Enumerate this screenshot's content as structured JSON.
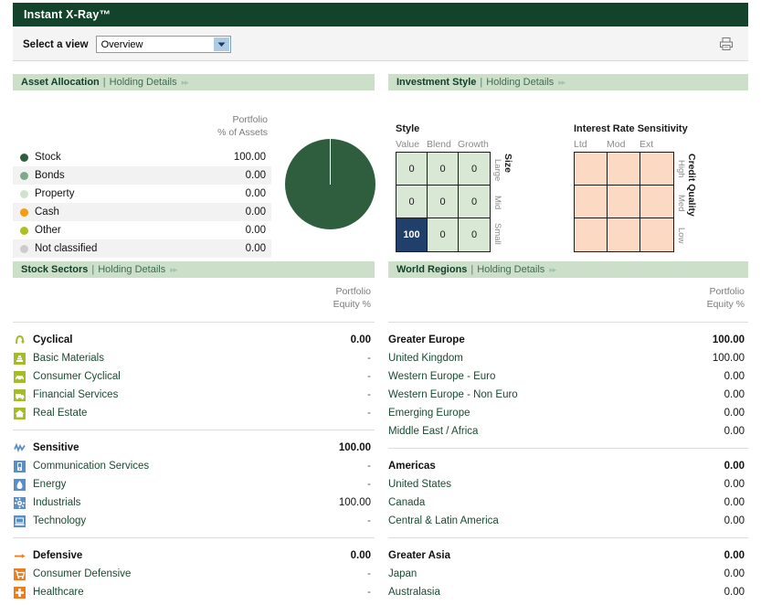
{
  "window": {
    "title": "Instant X-Ray™"
  },
  "toolbar": {
    "select_label": "Select a view",
    "view_value": "Overview",
    "view_options": [
      "Overview"
    ],
    "print_icon": "printer-icon",
    "dropdown_icon": "chevron-down-icon"
  },
  "panels": {
    "asset_allocation": {
      "title": "Asset Allocation",
      "separator": "|",
      "link": "Holding Details",
      "arrows": "▸▸",
      "col_header_line1": "Portfolio",
      "col_header_line2": "% of Assets",
      "rows": [
        {
          "label": "Stock",
          "value": "100.00",
          "color": "#2f5e3f"
        },
        {
          "label": "Bonds",
          "value": "0.00",
          "color": "#7fa98a"
        },
        {
          "label": "Property",
          "value": "0.00",
          "color": "#cfe4cd"
        },
        {
          "label": "Cash",
          "value": "0.00",
          "color": "#f59b12"
        },
        {
          "label": "Other",
          "value": "0.00",
          "color": "#afc024"
        },
        {
          "label": "Not classified",
          "value": "0.00",
          "color": "#cccccc"
        }
      ],
      "pie": {
        "slice_color": "#2f5e3f",
        "slice_value": 100
      }
    },
    "investment_style": {
      "title": "Investment Style",
      "separator": "|",
      "link": "Holding Details",
      "arrows": "▸▸",
      "style_box": {
        "title": "Style",
        "columns": [
          "Value",
          "Blend",
          "Growth"
        ],
        "rows": [
          "Large",
          "Mid",
          "Small"
        ],
        "axis_name": "Size",
        "values": [
          [
            "0",
            "0",
            "0"
          ],
          [
            "0",
            "0",
            "0"
          ],
          [
            "100",
            "0",
            "0"
          ]
        ],
        "highlight_row": 2,
        "highlight_col": 0,
        "cell_color": "#d8e8d5",
        "highlight_color": "#20406b"
      },
      "interest_rate_box": {
        "title": "Interest Rate Sensitivity",
        "columns": [
          "Ltd",
          "Mod",
          "Ext"
        ],
        "rows": [
          "High",
          "Med",
          "Low"
        ],
        "axis_name": "Credit Quality",
        "values": [
          [
            "",
            "",
            ""
          ],
          [
            "",
            "",
            ""
          ],
          [
            "",
            "",
            ""
          ]
        ],
        "cell_color": "#fbd9c2"
      }
    },
    "stock_sectors": {
      "title": "Stock Sectors",
      "separator": "|",
      "link": "Holding Details",
      "arrows": "▸▸",
      "col_header_line1": "Portfolio",
      "col_header_line2": "Equity %",
      "groups": [
        {
          "name": "Cyclical",
          "value": "0.00",
          "icon": "cyclical-icon",
          "color": "#a4bc2a",
          "items": [
            {
              "label": "Basic Materials",
              "value": "-",
              "icon": "basic-materials-icon"
            },
            {
              "label": "Consumer Cyclical",
              "value": "-",
              "icon": "consumer-cyclical-icon"
            },
            {
              "label": "Financial Services",
              "value": "-",
              "icon": "financial-services-icon"
            },
            {
              "label": "Real Estate",
              "value": "-",
              "icon": "real-estate-icon"
            }
          ]
        },
        {
          "name": "Sensitive",
          "value": "100.00",
          "icon": "sensitive-icon",
          "color": "#5b8ec4",
          "items": [
            {
              "label": "Communication Services",
              "value": "-",
              "icon": "communication-services-icon"
            },
            {
              "label": "Energy",
              "value": "-",
              "icon": "energy-icon"
            },
            {
              "label": "Industrials",
              "value": "100.00",
              "icon": "industrials-icon"
            },
            {
              "label": "Technology",
              "value": "-",
              "icon": "technology-icon"
            }
          ]
        },
        {
          "name": "Defensive",
          "value": "0.00",
          "icon": "defensive-icon",
          "color": "#ee7d19",
          "items": [
            {
              "label": "Consumer Defensive",
              "value": "-",
              "icon": "consumer-defensive-icon"
            },
            {
              "label": "Healthcare",
              "value": "-",
              "icon": "healthcare-icon"
            }
          ]
        }
      ]
    },
    "world_regions": {
      "title": "World Regions",
      "separator": "|",
      "link": "Holding Details",
      "arrows": "▸▸",
      "col_header_line1": "Portfolio",
      "col_header_line2": "Equity %",
      "groups": [
        {
          "name": "Greater Europe",
          "value": "100.00",
          "items": [
            {
              "label": "United Kingdom",
              "value": "100.00"
            },
            {
              "label": "Western Europe - Euro",
              "value": "0.00"
            },
            {
              "label": "Western Europe - Non Euro",
              "value": "0.00"
            },
            {
              "label": "Emerging Europe",
              "value": "0.00"
            },
            {
              "label": "Middle East / Africa",
              "value": "0.00"
            }
          ]
        },
        {
          "name": "Americas",
          "value": "0.00",
          "items": [
            {
              "label": "United States",
              "value": "0.00"
            },
            {
              "label": "Canada",
              "value": "0.00"
            },
            {
              "label": "Central & Latin America",
              "value": "0.00"
            }
          ]
        },
        {
          "name": "Greater Asia",
          "value": "0.00",
          "items": [
            {
              "label": "Japan",
              "value": "0.00"
            },
            {
              "label": "Australasia",
              "value": "0.00"
            }
          ]
        }
      ]
    }
  },
  "chart_data": {
    "type": "pie",
    "title": "Asset Allocation",
    "categories": [
      "Stock",
      "Bonds",
      "Property",
      "Cash",
      "Other",
      "Not classified"
    ],
    "values": [
      100.0,
      0.0,
      0.0,
      0.0,
      0.0,
      0.0
    ],
    "unit": "% of Assets",
    "colors": [
      "#2f5e3f",
      "#7fa98a",
      "#cfe4cd",
      "#f59b12",
      "#afc024",
      "#cccccc"
    ],
    "legend": "left"
  }
}
